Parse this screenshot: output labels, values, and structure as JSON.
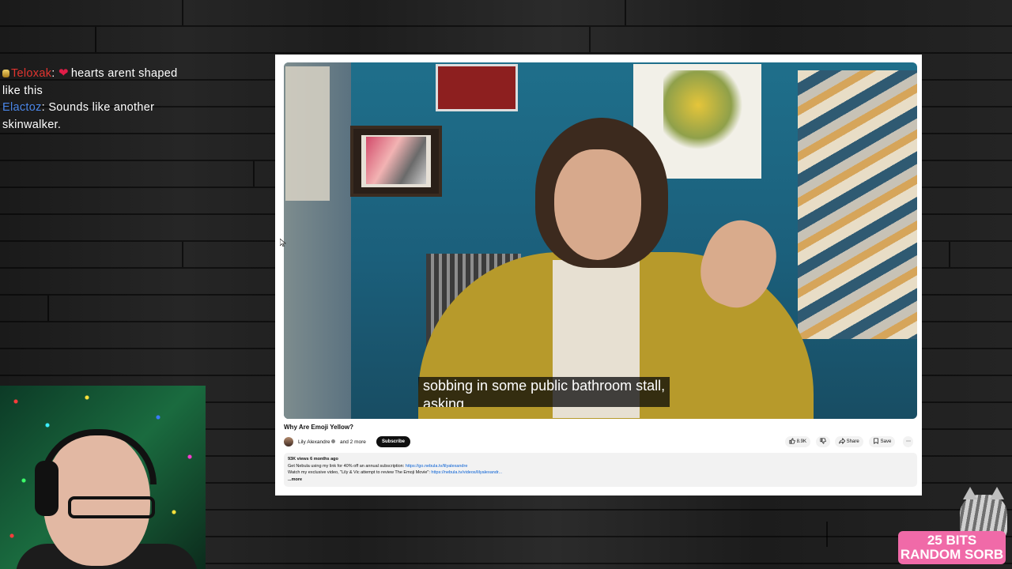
{
  "chat": {
    "messages": [
      {
        "user": "Teloxak",
        "user_color": "#e0342f",
        "text": "hearts arent shaped like this",
        "badge": "gold-badge-icon",
        "emote": "heart-icon"
      },
      {
        "user": "Elactoz",
        "user_color": "#4a86e8",
        "text": "Sounds like another skinwalker."
      }
    ]
  },
  "youtube": {
    "caption_line_1": "sobbing in some public bathroom stall,",
    "caption_line_2": "asking,",
    "video_title": "Why Are Emoji Yellow?",
    "channel_name": "Lily Alexandre",
    "channel_extra": "and 2 more",
    "subscribe_label": "Subscribe",
    "likes": "8.9K",
    "share_label": "Share",
    "save_label": "Save",
    "description": {
      "stats": "93K views  6 months ago",
      "line1_text": "Get Nebula using my link for 40% off an annual subscription: ",
      "line1_link": "https://go.nebula.tv/lilyalexandre",
      "line2_text": "Watch my exclusive video, \"Lily & Vic attempt to review The Emoji Movie\": ",
      "line2_link": "https://nebula.tv/videos/lilyalexandr...",
      "more_label": "...more"
    }
  },
  "alert": {
    "bits": "25 BITS",
    "username": "RANDOM SORB",
    "color": "#f06aa8"
  }
}
